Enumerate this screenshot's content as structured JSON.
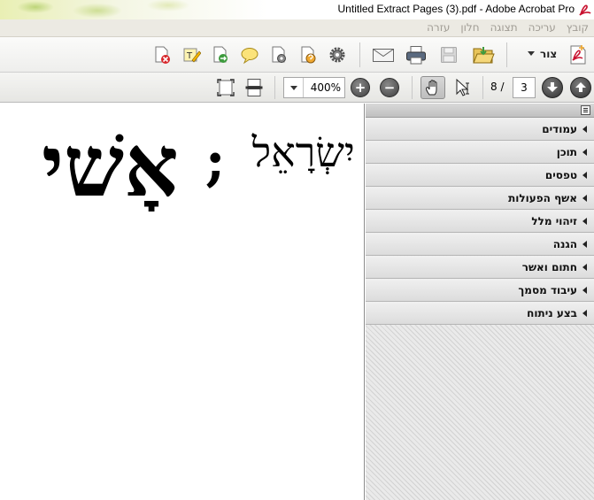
{
  "window": {
    "title": "Untitled Extract Pages (3).pdf - Adobe Acrobat Pro"
  },
  "menubar": {
    "items": [
      "קובץ",
      "עריכה",
      "תצוגה",
      "חלון",
      "עזרה"
    ]
  },
  "toolbar": {
    "create_label": "צור",
    "icons": [
      "delete-pages-icon",
      "edit-text-icon",
      "extract-pages-icon",
      "comment-icon",
      "page-settings-icon",
      "document-settings-icon",
      "gear-icon",
      "envelope-icon",
      "print-icon",
      "save-icon",
      "open-folder-icon",
      "create-pdf-icon"
    ]
  },
  "navigation": {
    "zoom": "400%",
    "current_page": "3",
    "page_count_label": "8 /"
  },
  "document": {
    "word1": "יִשְׂרָאֵל",
    "separator": ";",
    "word2": "אָשׁי"
  },
  "right_pane": {
    "panels": [
      "עמודים",
      "תוכן",
      "טפסים",
      "אשף הפעולות",
      "זיהוי מלל",
      "הגנה",
      "חתום ואשר",
      "עיבוד מסמך",
      "בצע ניתוח"
    ]
  },
  "colors": {
    "accent_red": "#c8102e",
    "toolbar_bg": "#eeeeec",
    "panel_bg": "#dcdcdc"
  }
}
